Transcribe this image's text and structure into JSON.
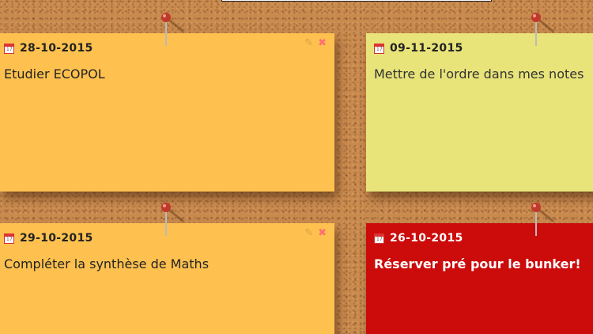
{
  "notes": [
    {
      "date": "28-10-2015",
      "text": "Etudier ECOPOL",
      "color": "#fec14f",
      "icons": [
        "calendar-icon",
        "pencil-icon",
        "close-icon"
      ]
    },
    {
      "date": "09-11-2015",
      "text": "Mettre de l'ordre dans mes notes",
      "color": "#e8e47a",
      "icons": [
        "calendar-icon"
      ]
    },
    {
      "date": "29-10-2015",
      "text": "Compléter la synthèse de Maths",
      "color": "#fec14f",
      "icons": [
        "calendar-icon",
        "pencil-icon",
        "close-icon"
      ]
    },
    {
      "date": "26-10-2015",
      "text": "Réserver pré pour le bunker!",
      "color": "#cc0b0b",
      "icons": [
        "calendar-icon"
      ]
    }
  ],
  "actions": {
    "edit_glyph": "✎",
    "delete_glyph": "✖"
  },
  "colors": {
    "corkboard": "#c98a4e",
    "pin_head": "#c0392b"
  }
}
